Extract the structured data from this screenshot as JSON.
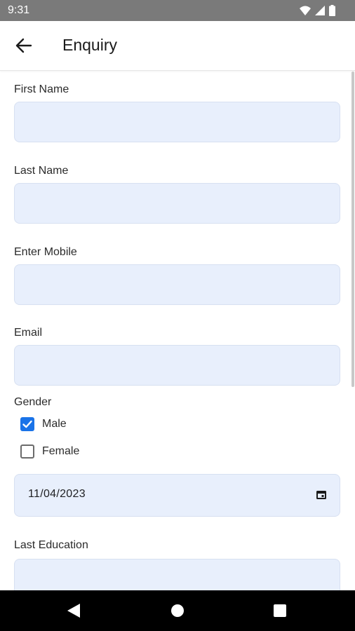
{
  "status_bar": {
    "time": "9:31"
  },
  "app_bar": {
    "title": "Enquiry"
  },
  "form": {
    "first_name": {
      "label": "First Name",
      "value": ""
    },
    "last_name": {
      "label": "Last Name",
      "value": ""
    },
    "mobile": {
      "label": "Enter Mobile",
      "value": ""
    },
    "email": {
      "label": "Email",
      "value": ""
    },
    "gender": {
      "label": "Gender",
      "options": [
        {
          "label": "Male",
          "checked": true
        },
        {
          "label": "Female",
          "checked": false
        }
      ]
    },
    "date": {
      "value": "11/04/2023"
    },
    "last_education": {
      "label": "Last Education",
      "value": ""
    }
  },
  "colors": {
    "field_bg": "#e8effc",
    "accent": "#1a73e8",
    "status_bar": "#7a7a7a"
  },
  "icons": {
    "back": "arrow-left-icon",
    "calendar": "calendar-icon",
    "wifi": "wifi-icon",
    "signal": "signal-icon",
    "battery": "battery-icon"
  }
}
